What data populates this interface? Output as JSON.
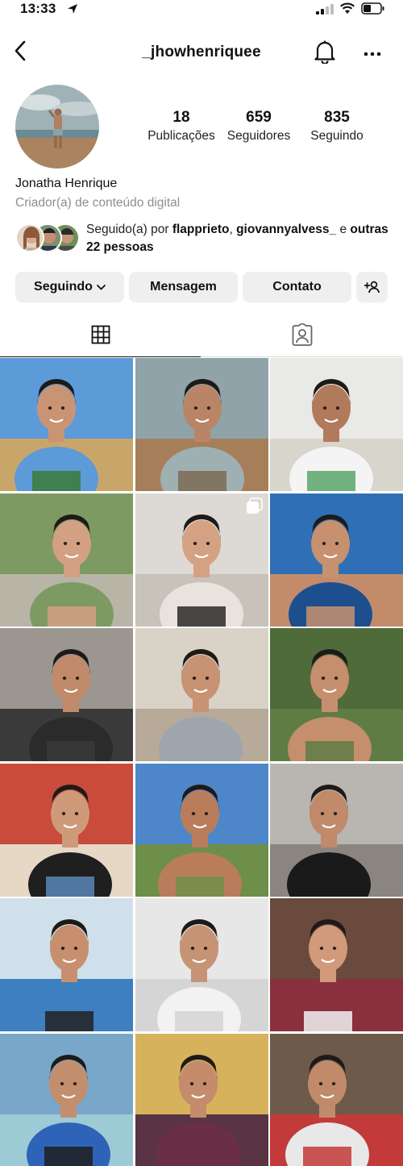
{
  "status_bar": {
    "time": "13:33",
    "icons": [
      "location-arrow-icon",
      "cellular-signal-icon",
      "wifi-icon",
      "battery-icon"
    ]
  },
  "header": {
    "username": "_jhowhenriquee",
    "icons": [
      "back-chevron-icon",
      "bell-icon",
      "more-dots-icon"
    ]
  },
  "profile": {
    "stats": [
      {
        "value": "18",
        "label": "Publicações"
      },
      {
        "value": "659",
        "label": "Seguidores"
      },
      {
        "value": "835",
        "label": "Seguindo"
      }
    ],
    "name": "Jonatha Henrique",
    "category": "Criador(a) de conteúdo digital",
    "followed_by": {
      "prefix": "Seguido(a) por ",
      "user1": "flapprieto",
      "separator": ", ",
      "user2": "giovannyalvess_",
      "conj": " e ",
      "others": "outras 22 pessoas"
    }
  },
  "actions": {
    "following": "Seguindo",
    "message": "Mensagem",
    "contact": "Contato"
  },
  "tabs": [
    "grid-icon",
    "tagged-icon"
  ],
  "posts": [
    {
      "scene": "beach-signpost",
      "sky": "#5d9ad8",
      "ground": "#c8a66a",
      "skin": "#c99474",
      "top": "#5d9ad8",
      "bottom": "#3a7a3a"
    },
    {
      "scene": "beach-standing",
      "sky": "#8fa3a8",
      "ground": "#a67f5a",
      "skin": "#b98566",
      "top": "#9fb0b3",
      "bottom": "#7d6b55"
    },
    {
      "scene": "white-wall-door",
      "sky": "#e9e9e6",
      "ground": "#d8d5cc",
      "skin": "#b17a5b",
      "top": "#f4f4f4",
      "bottom": "#5aa46b"
    },
    {
      "scene": "pool-drink",
      "sky": "#7e9a63",
      "ground": "#b8b5a6",
      "skin": "#d3a084",
      "top": "#7e9a63",
      "bottom": "#d3a084"
    },
    {
      "scene": "mirror-couple",
      "sky": "#dddad5",
      "ground": "#c8c3ba",
      "skin": "#d4a283",
      "top": "#e8e4dd",
      "bottom": "#2a2a2a"
    },
    {
      "scene": "hat-selfie",
      "sky": "#2f6fb6",
      "ground": "#c28c6b",
      "skin": "#c7906f",
      "top": "#1d4f8f",
      "bottom": "#c7906f"
    },
    {
      "scene": "car-selfie",
      "sky": "#9c9690",
      "ground": "#3a3a3a",
      "skin": "#c08a6b",
      "top": "#2b2b2b",
      "bottom": "#3a3a3a"
    },
    {
      "scene": "glasses-selfie",
      "sky": "#d9d2c7",
      "ground": "#b7aa98",
      "skin": "#c79373",
      "top": "#9ea5ad",
      "bottom": "#9ea5ad"
    },
    {
      "scene": "leaves-shirtless",
      "sky": "#4f6b3a",
      "ground": "#5f7c45",
      "skin": "#c58e6c",
      "top": "#c58e6c",
      "bottom": "#5f7c45"
    },
    {
      "scene": "cafe-couple",
      "sky": "#c84b3b",
      "ground": "#e6d8c5",
      "skin": "#cf9a7a",
      "top": "#1f1f1f",
      "bottom": "#5a87b8"
    },
    {
      "scene": "tree-selfie",
      "sky": "#4d87c9",
      "ground": "#6e8f4a",
      "skin": "#b97d5c",
      "top": "#b97d5c",
      "bottom": "#6e8f4a"
    },
    {
      "scene": "car-black-tee",
      "sky": "#b9b6b1",
      "ground": "#8a8580",
      "skin": "#c08a6b",
      "top": "#1a1a1a",
      "bottom": "#1a1a1a"
    },
    {
      "scene": "couple-kiss",
      "sky": "#cfe0ea",
      "ground": "#3d7fbf",
      "skin": "#c88f6e",
      "top": "#3d7fbf",
      "bottom": "#222222"
    },
    {
      "scene": "mirror-white-tee",
      "sky": "#e7e7e7",
      "ground": "#d5d5d5",
      "skin": "#c69475",
      "top": "#f2f2f2",
      "bottom": "#d5d5d5"
    },
    {
      "scene": "couple-selfie",
      "sky": "#6a4a3d",
      "ground": "#8a2f3e",
      "skin": "#d09a7b",
      "top": "#8a2f3e",
      "bottom": "#f1f1f1"
    },
    {
      "scene": "sea-couple",
      "sky": "#79a7c9",
      "ground": "#9ccbd5",
      "skin": "#c38e6d",
      "top": "#2f63b8",
      "bottom": "#1f1f1f"
    },
    {
      "scene": "yellow-wall-selfie",
      "sky": "#d7b25d",
      "ground": "#5a3344",
      "skin": "#c48c6c",
      "top": "#6a2f45",
      "bottom": "#6a2f45"
    },
    {
      "scene": "mirror-red-jacket",
      "sky": "#6d5a4a",
      "ground": "#c23a3a",
      "skin": "#c08a6b",
      "top": "#e8e8e8",
      "bottom": "#c23a3a"
    }
  ]
}
